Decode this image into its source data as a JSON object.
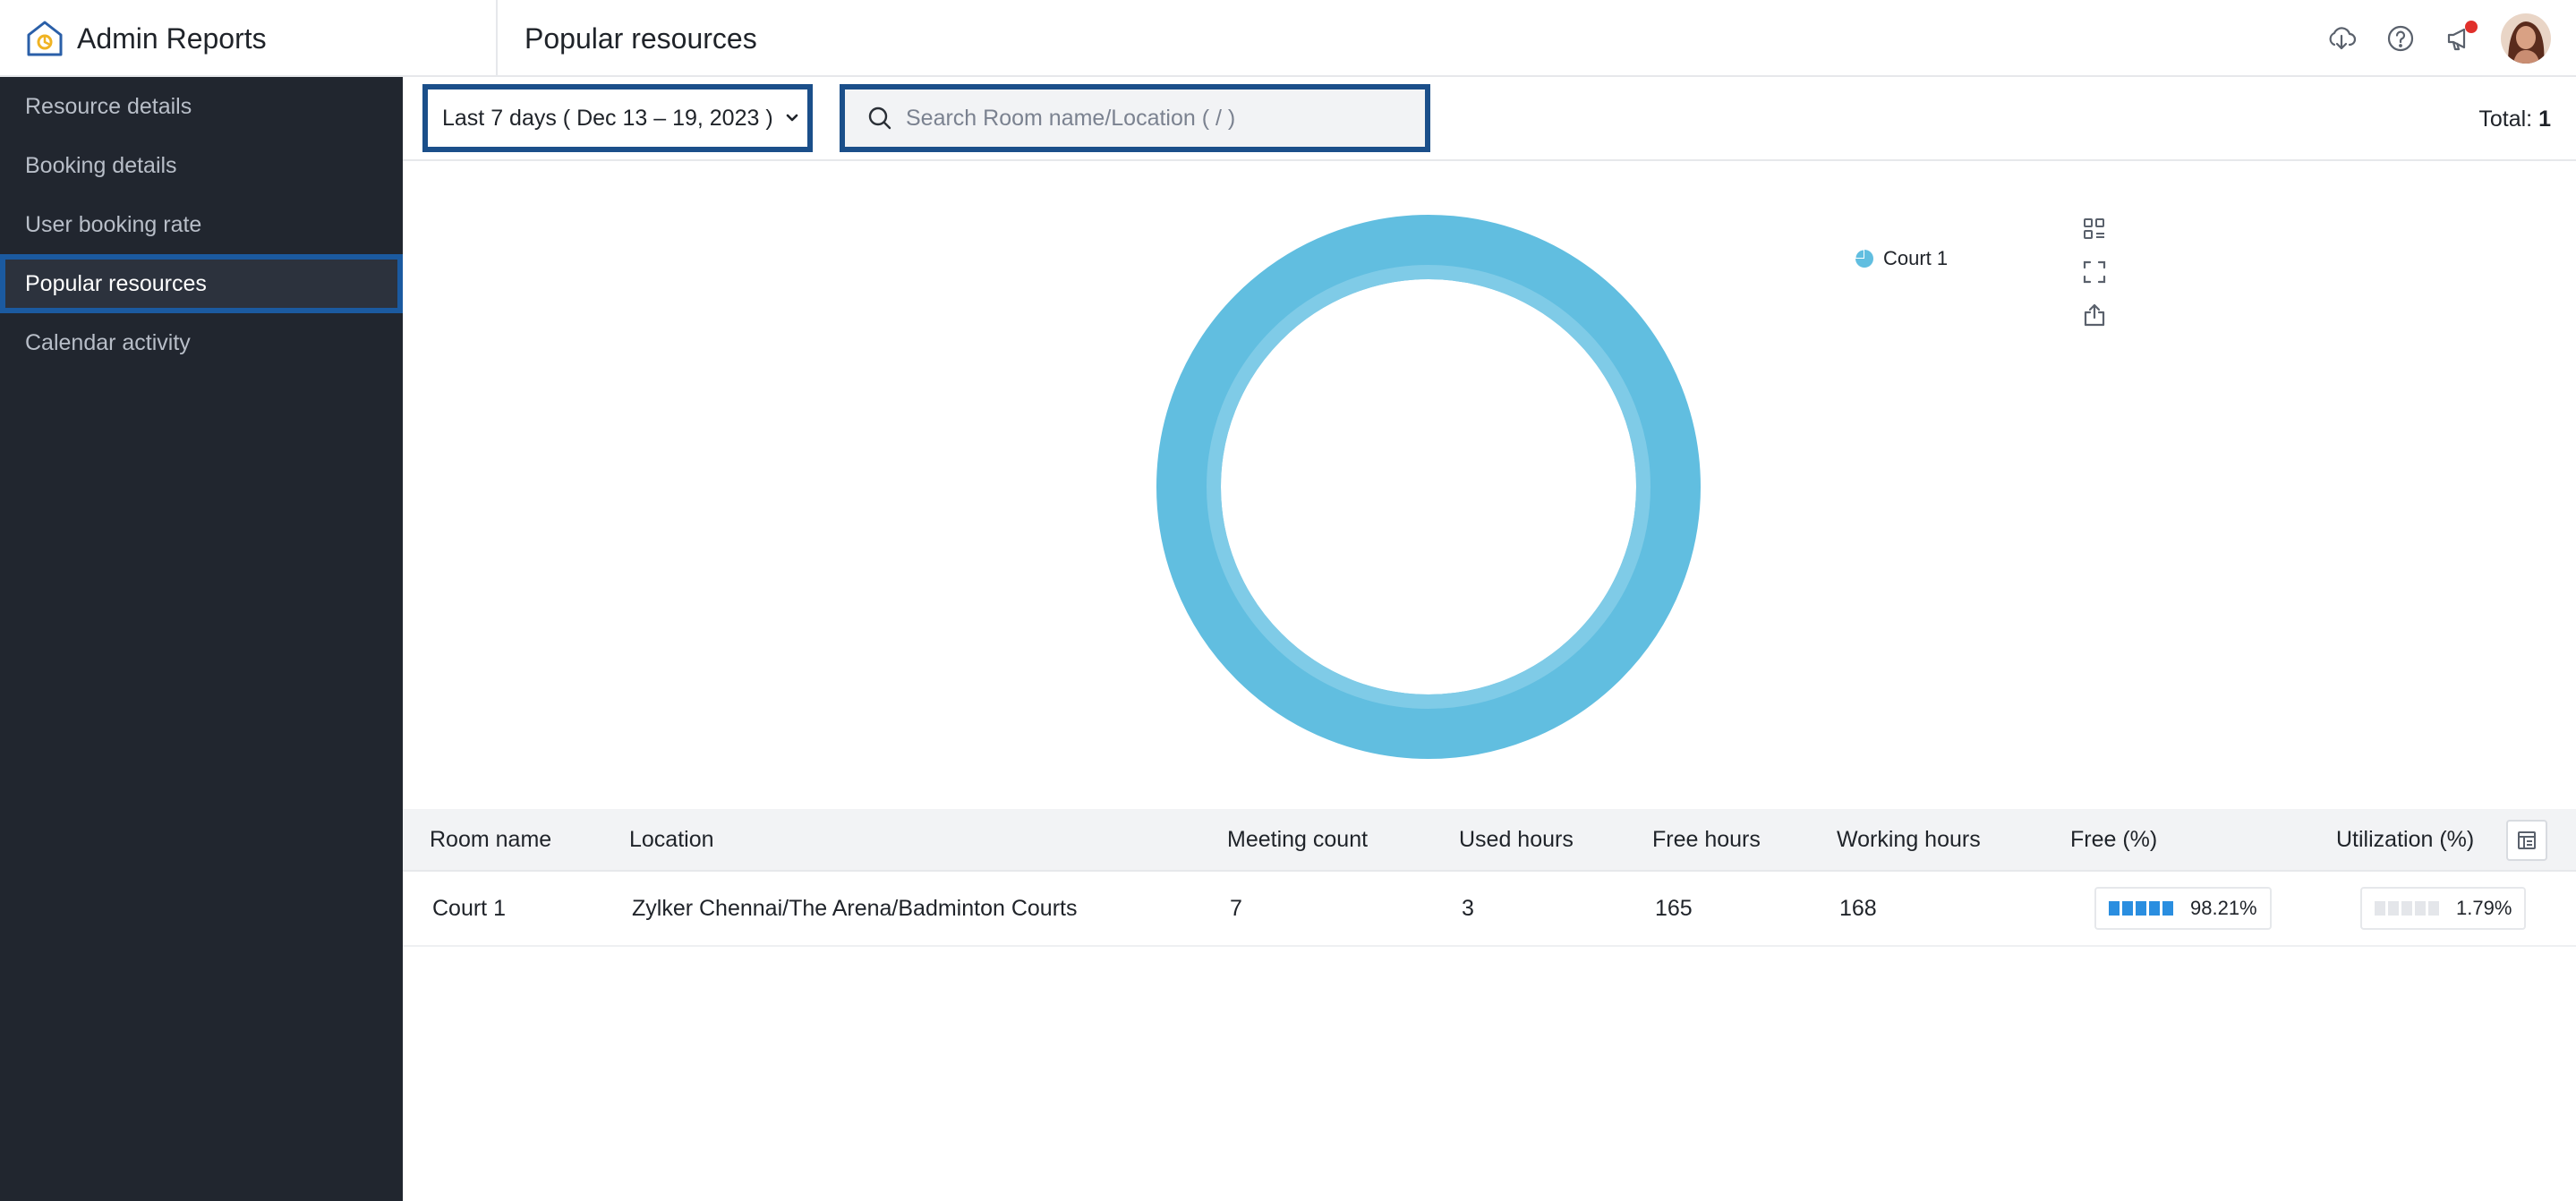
{
  "app": {
    "title": "Admin Reports"
  },
  "page": {
    "title": "Popular resources"
  },
  "sidebar": {
    "items": [
      {
        "label": "Resource details"
      },
      {
        "label": "Booking details"
      },
      {
        "label": "User booking rate"
      },
      {
        "label": "Popular resources",
        "active": true
      },
      {
        "label": "Calendar activity"
      }
    ]
  },
  "toolbar": {
    "date_range": "Last 7 days ( Dec 13 – 19, 2023 )",
    "search_placeholder": "Search Room name/Location ( / )",
    "search_value": "",
    "total_label": "Total:",
    "total_value": "1"
  },
  "header_icons": [
    "download-cloud-icon",
    "help-icon",
    "announcement-icon",
    "avatar"
  ],
  "chart_icons": [
    "legend-toggle-icon",
    "fullscreen-icon",
    "export-icon"
  ],
  "colors": {
    "donut": "#61bee0",
    "accent": "#1b4f8a",
    "sidebar_bg": "#21262f",
    "bar_on": "#2a8ee0"
  },
  "chart_data": {
    "type": "pie",
    "style": "donut",
    "categories": [
      "Court 1"
    ],
    "values": [
      7
    ],
    "legend": [
      "Court 1"
    ],
    "legend_position": "top-right"
  },
  "table": {
    "columns": [
      "Room name",
      "Location",
      "Meeting count",
      "Used hours",
      "Free hours",
      "Working hours",
      "Free (%)",
      "Utilization (%)"
    ],
    "rows": [
      {
        "room": "Court 1",
        "location": "Zylker Chennai/The Arena/Badminton Courts",
        "meeting_count": "7",
        "used_hours": "3",
        "free_hours": "165",
        "working_hours": "168",
        "free_pct": "98.21%",
        "free_pct_value": 98.21,
        "util_pct": "1.79%",
        "util_pct_value": 1.79
      }
    ]
  }
}
